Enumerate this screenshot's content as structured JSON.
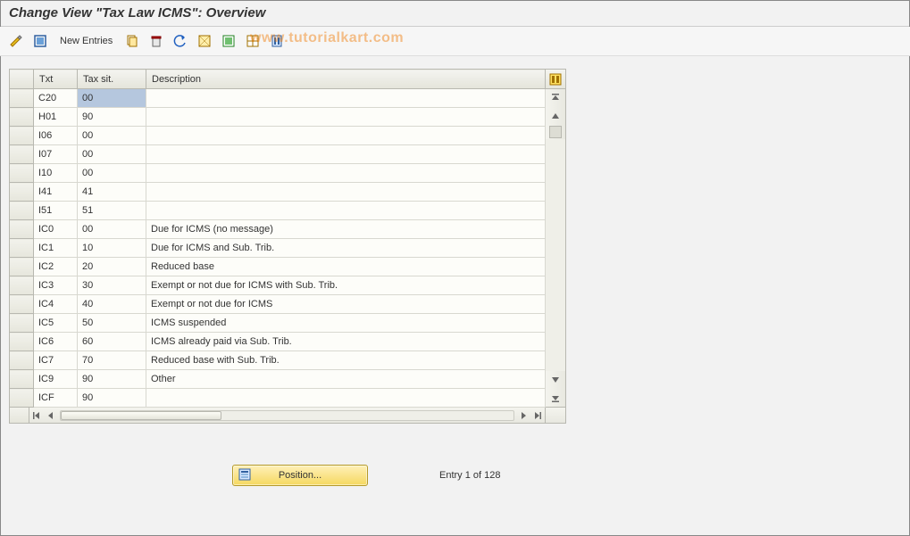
{
  "title": "Change View \"Tax Law ICMS\": Overview",
  "watermark": "www.tutorialkart.com",
  "toolbar": {
    "new_entries": "New Entries"
  },
  "columns": {
    "rowhead": "",
    "txt": "Txt",
    "sit": "Tax sit.",
    "desc": "Description"
  },
  "rows": [
    {
      "txt": "C20",
      "sit": "00",
      "desc": ""
    },
    {
      "txt": "H01",
      "sit": "90",
      "desc": ""
    },
    {
      "txt": "I06",
      "sit": "00",
      "desc": ""
    },
    {
      "txt": "I07",
      "sit": "00",
      "desc": ""
    },
    {
      "txt": "I10",
      "sit": "00",
      "desc": ""
    },
    {
      "txt": "I41",
      "sit": "41",
      "desc": ""
    },
    {
      "txt": "I51",
      "sit": "51",
      "desc": ""
    },
    {
      "txt": "IC0",
      "sit": "00",
      "desc": "Due for ICMS (no message)"
    },
    {
      "txt": "IC1",
      "sit": "10",
      "desc": "Due for ICMS and Sub. Trib."
    },
    {
      "txt": "IC2",
      "sit": "20",
      "desc": "Reduced base"
    },
    {
      "txt": "IC3",
      "sit": "30",
      "desc": "Exempt or not due for ICMS with Sub. Trib."
    },
    {
      "txt": "IC4",
      "sit": "40",
      "desc": "Exempt or not due for ICMS"
    },
    {
      "txt": "IC5",
      "sit": "50",
      "desc": "ICMS suspended"
    },
    {
      "txt": "IC6",
      "sit": "60",
      "desc": "ICMS already paid via Sub. Trib."
    },
    {
      "txt": "IC7",
      "sit": "70",
      "desc": "Reduced base with Sub. Trib."
    },
    {
      "txt": "IC9",
      "sit": "90",
      "desc": "Other"
    },
    {
      "txt": "ICF",
      "sit": "90",
      "desc": ""
    }
  ],
  "footer": {
    "position_label": "Position...",
    "entry_info": "Entry 1 of 128"
  }
}
